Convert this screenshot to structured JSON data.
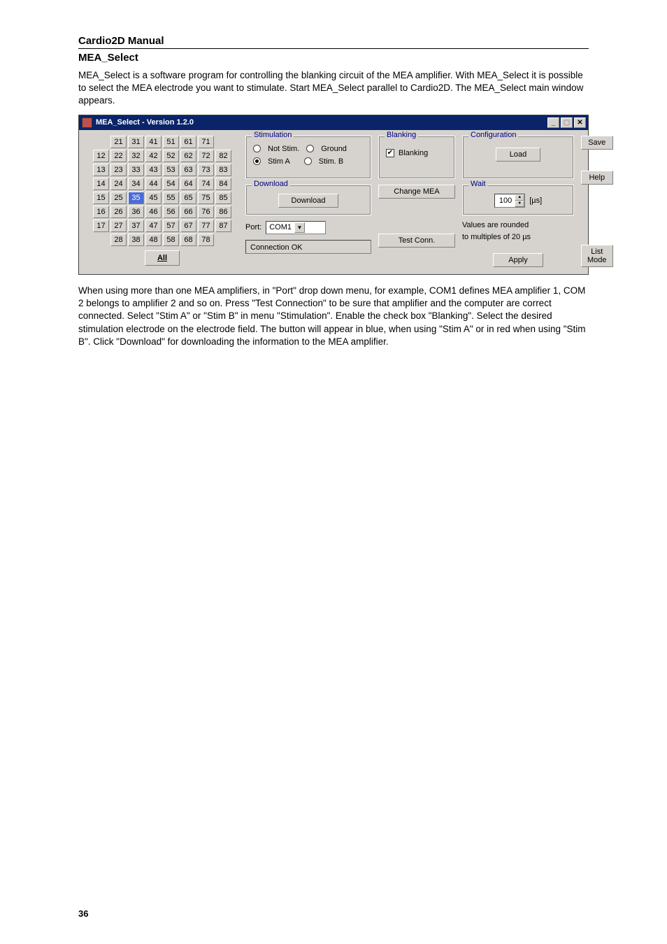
{
  "doc": {
    "header": "Cardio2D Manual",
    "section": "MEA_Select",
    "intro": "MEA_Select is a software program for controlling the blanking circuit of the MEA amplifier. With MEA_Select it is possible to select the MEA electrode you want to stimulate. Start MEA_Select parallel to Cardio2D. The MEA_Select main window appears.",
    "outro": "When using more than one MEA amplifiers, in \"Port\" drop down menu, for example, COM1 defines MEA amplifier 1, COM 2 belongs to amplifier 2 and so on. Press \"Test Connection\" to be sure that amplifier and the computer are correct connected. Select \"Stim A\" or \"Stim B\" in menu \"Stimulation\". Enable the check box \"Blanking\". Select the desired stimulation electrode on the electrode field. The button will appear in blue, when using \"Stim A\" or in red when using \"Stim B\". Click \"Download\" for downloading the information to the MEA amplifier.",
    "page_number": "36"
  },
  "window": {
    "title": "MEA_Select  -  Version 1.2.0"
  },
  "electrodes": {
    "rows": [
      [
        "",
        "21",
        "31",
        "41",
        "51",
        "61",
        "71",
        ""
      ],
      [
        "12",
        "22",
        "32",
        "42",
        "52",
        "62",
        "72",
        "82"
      ],
      [
        "13",
        "23",
        "33",
        "43",
        "53",
        "63",
        "73",
        "83"
      ],
      [
        "14",
        "24",
        "34",
        "44",
        "54",
        "64",
        "74",
        "84"
      ],
      [
        "15",
        "25",
        "35",
        "45",
        "55",
        "65",
        "75",
        "85"
      ],
      [
        "16",
        "26",
        "36",
        "46",
        "56",
        "66",
        "76",
        "86"
      ],
      [
        "17",
        "27",
        "37",
        "47",
        "57",
        "67",
        "77",
        "87"
      ],
      [
        "",
        "28",
        "38",
        "48",
        "58",
        "68",
        "78",
        ""
      ]
    ],
    "selected_stimA": [
      "35"
    ],
    "all_label": "All"
  },
  "stim": {
    "legend": "Stimulation",
    "not_stim": "Not Stim.",
    "ground": "Ground",
    "stim_a": "Stim A",
    "stim_b": "Stim. B",
    "selected": "stim_a"
  },
  "blanking": {
    "legend": "Blanking",
    "label": "Blanking",
    "checked": true,
    "change_mea": "Change MEA",
    "test_conn": "Test Conn."
  },
  "download": {
    "legend": "Download",
    "button": "Download"
  },
  "port": {
    "label": "Port:",
    "value": "COM1"
  },
  "status": {
    "text": "Connection OK"
  },
  "config": {
    "legend": "Configuration",
    "load": "Load",
    "save": "Save"
  },
  "wait": {
    "legend": "Wait",
    "value": "100",
    "unit": "[µs]",
    "note1": "Values are rounded",
    "note2": "to multiples of 20 µs"
  },
  "buttons": {
    "help": "Help",
    "apply": "Apply",
    "list_mode": "List Mode"
  }
}
